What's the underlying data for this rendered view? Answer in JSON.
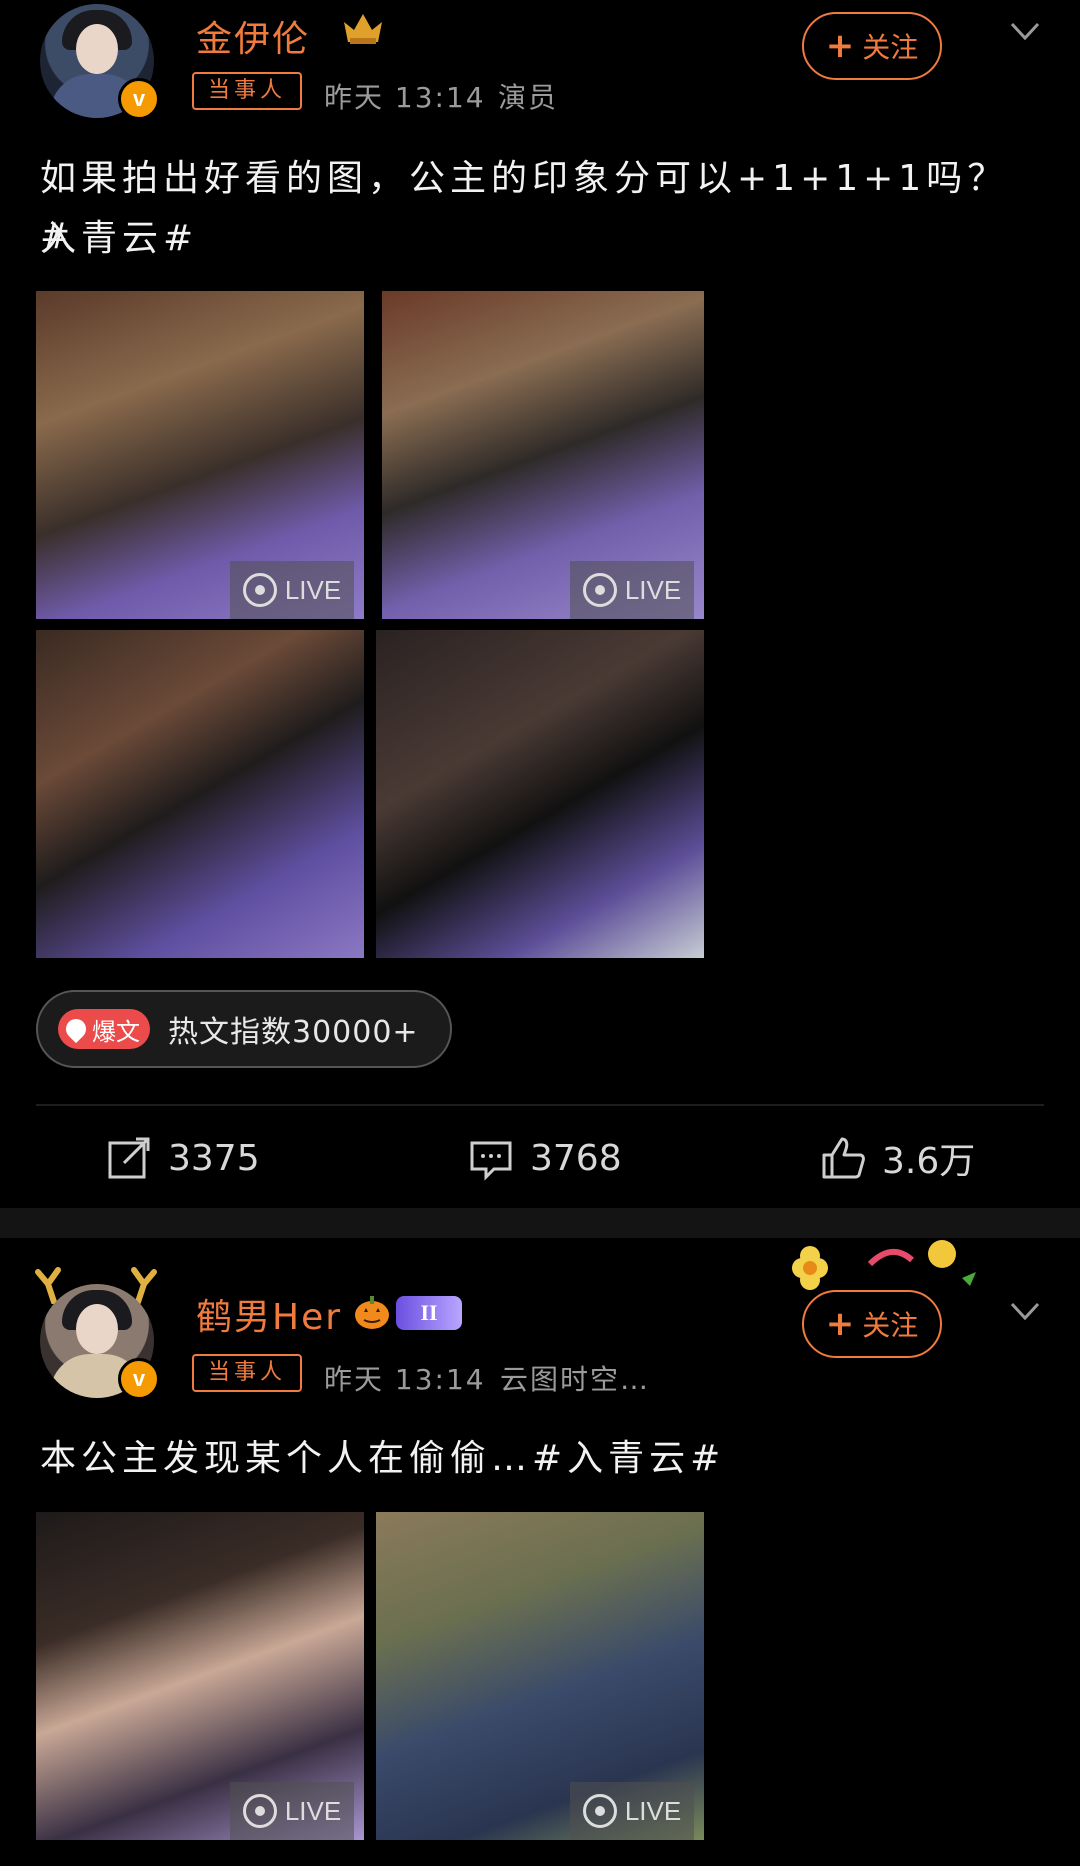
{
  "post1": {
    "username": "金伊伦",
    "tag": "当事人",
    "time": "昨天 13:14",
    "source": "演员",
    "follow_label": "关注",
    "text_line1": "如果拍出好看的图，公主的印象分可以+1+1+1吗？#",
    "text_line2": "入青云#",
    "live_label": "LIVE",
    "hot_badge": "爆文",
    "hot_text": "热文指数30000+",
    "repost_count": "3375",
    "comment_count": "3768",
    "like_count": "3.6万"
  },
  "post2": {
    "username": "鹤男Her",
    "level": "II",
    "tag": "当事人",
    "time": "昨天 13:14",
    "source": "云图时空…",
    "follow_label": "关注",
    "text": "本公主发现某个人在偷偷…#入青云#",
    "live_label": "LIVE"
  },
  "colors": {
    "accent": "#f07b3f",
    "background": "#000000",
    "verified": "#f59a00",
    "hot_badge": "#ec4b4b"
  }
}
